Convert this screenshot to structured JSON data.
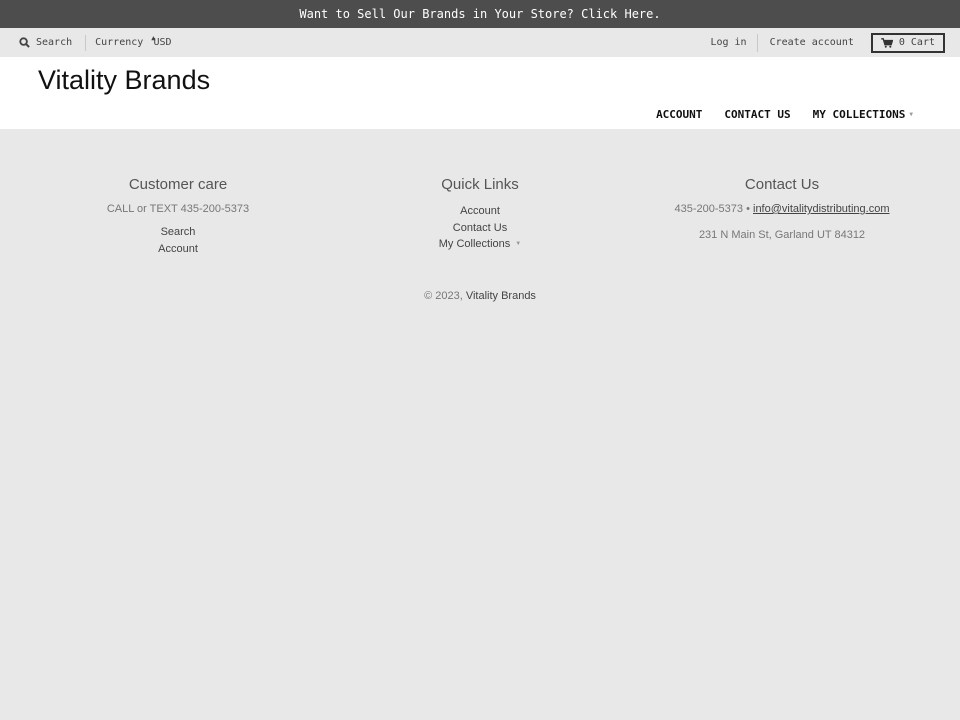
{
  "announcement": {
    "text": "Want to Sell Our Brands in Your Store? Click Here."
  },
  "utility": {
    "search_label": "Search",
    "currency_label": "Currency",
    "currency_value": "USD",
    "login_label": "Log in",
    "create_account_label": "Create account",
    "cart_count": "0",
    "cart_label": "Cart"
  },
  "header": {
    "logo": "Vitality Brands",
    "nav": [
      {
        "label": "ACCOUNT"
      },
      {
        "label": "CONTACT US"
      },
      {
        "label": "MY COLLECTIONS"
      }
    ]
  },
  "footer": {
    "customer_care": {
      "title": "Customer care",
      "text": "CALL or TEXT 435-200-5373",
      "links": [
        "Search",
        "Account"
      ]
    },
    "quick_links": {
      "title": "Quick Links",
      "links": [
        "Account",
        "Contact Us",
        "My Collections"
      ]
    },
    "contact": {
      "title": "Contact Us",
      "phone": "435-200-5373",
      "bullet": "•",
      "email": "info@vitalitydistributing.com",
      "address": "231 N Main St, Garland UT 84312"
    },
    "copyright_prefix": "© 2023,",
    "copyright_brand": "Vitality Brands"
  },
  "icons": {
    "search": "search-icon",
    "cart": "cart-icon",
    "caret": "chevron-down-icon"
  },
  "colors": {
    "announcement_bg": "#4d4d4d",
    "page_bg": "#e8e8e8",
    "header_bg": "#ffffff"
  }
}
